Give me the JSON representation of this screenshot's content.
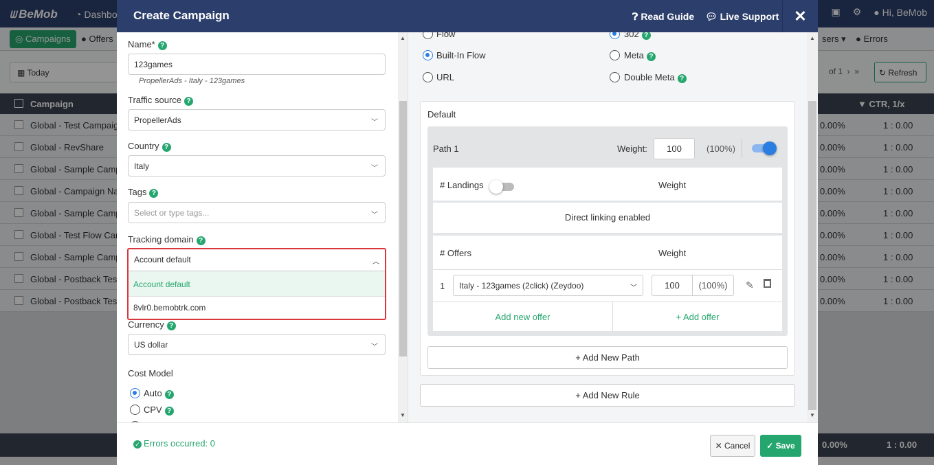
{
  "background": {
    "logo": "BeMob",
    "nav_dashboard": "Dashbo",
    "greeting": "Hi, BeMob",
    "tab_campaigns": "Campaigns",
    "tab_offers": "Offers",
    "tab_users": "sers",
    "tab_errors": "Errors",
    "date_range": "Today",
    "pager": "of 1",
    "refresh": "Refresh",
    "col_campaign": "Campaign",
    "col_ctr": "CTR, 1/x",
    "rows": [
      {
        "name": "Global - Test Campaign",
        "pct": "0.00%",
        "ctr": "1 : 0.00"
      },
      {
        "name": "Global - RevShare",
        "pct": "0.00%",
        "ctr": "1 : 0.00"
      },
      {
        "name": "Global - Sample Camp",
        "pct": "0.00%",
        "ctr": "1 : 0.00"
      },
      {
        "name": "Global - Campaign Nam",
        "pct": "0.00%",
        "ctr": "1 : 0.00"
      },
      {
        "name": "Global - Sample Camp",
        "pct": "0.00%",
        "ctr": "1 : 0.00"
      },
      {
        "name": "Global - Test Flow Cam",
        "pct": "0.00%",
        "ctr": "1 : 0.00"
      },
      {
        "name": "Global - Sample Camp",
        "pct": "0.00%",
        "ctr": "1 : 0.00"
      },
      {
        "name": "Global - Postback Test",
        "pct": "0.00%",
        "ctr": "1 : 0.00"
      },
      {
        "name": "Global - Postback Test",
        "pct": "0.00%",
        "ctr": "1 : 0.00"
      }
    ],
    "total_pct": "0.00%",
    "total_ctr": "1 : 0.00"
  },
  "modal": {
    "title": "Create Campaign",
    "read_guide": "Read Guide",
    "live_support": "Live Support",
    "close": "✕"
  },
  "form": {
    "name_label": "Name*",
    "name_value": "123games",
    "name_hint": "PropellerAds - Italy - 123games",
    "traffic_label": "Traffic source",
    "traffic_value": "PropellerAds",
    "country_label": "Country",
    "country_value": "Italy",
    "tags_label": "Tags",
    "tags_placeholder": "Select or type tags...",
    "domain_label": "Tracking domain",
    "domain_value": "Account default",
    "domain_options": [
      "Account default",
      "8vlr0.bemobtrk.com"
    ],
    "currency_label": "Currency",
    "currency_value": "US dollar",
    "cost_model_label": "Cost Model",
    "cost_models": [
      "Auto",
      "CPV"
    ]
  },
  "destination": {
    "options_left": [
      "Flow",
      "Built-In Flow",
      "URL"
    ],
    "selected_left": "Built-In Flow",
    "options_right": [
      "302",
      "Meta",
      "Double Meta"
    ],
    "selected_right": "302"
  },
  "flow": {
    "default_title": "Default",
    "path_title": "Path 1",
    "weight_label": "Weight:",
    "path_weight": "100",
    "path_pct": "(100%)",
    "path_enabled": true,
    "landings_label": "# Landings",
    "landings_enabled": false,
    "weight_col": "Weight",
    "direct_linking": "Direct linking enabled",
    "offers_label": "# Offers",
    "offer_index": "1",
    "offer_value": "Italy - 123games (2click) (Zeydoo)",
    "offer_weight": "100",
    "offer_pct": "(100%)",
    "add_new_offer": "Add new offer",
    "add_offer": "+ Add offer",
    "add_new_path": "+ Add New Path",
    "add_new_rule": "+ Add New Rule"
  },
  "footer": {
    "errors": "Errors occurred: 0",
    "cancel": "Cancel",
    "save": "Save"
  },
  "colors": {
    "brand_navy": "#2c3e6b",
    "accent_green": "#26a66f",
    "radio_blue": "#2a7de1",
    "highlight_red": "#d9363e"
  }
}
